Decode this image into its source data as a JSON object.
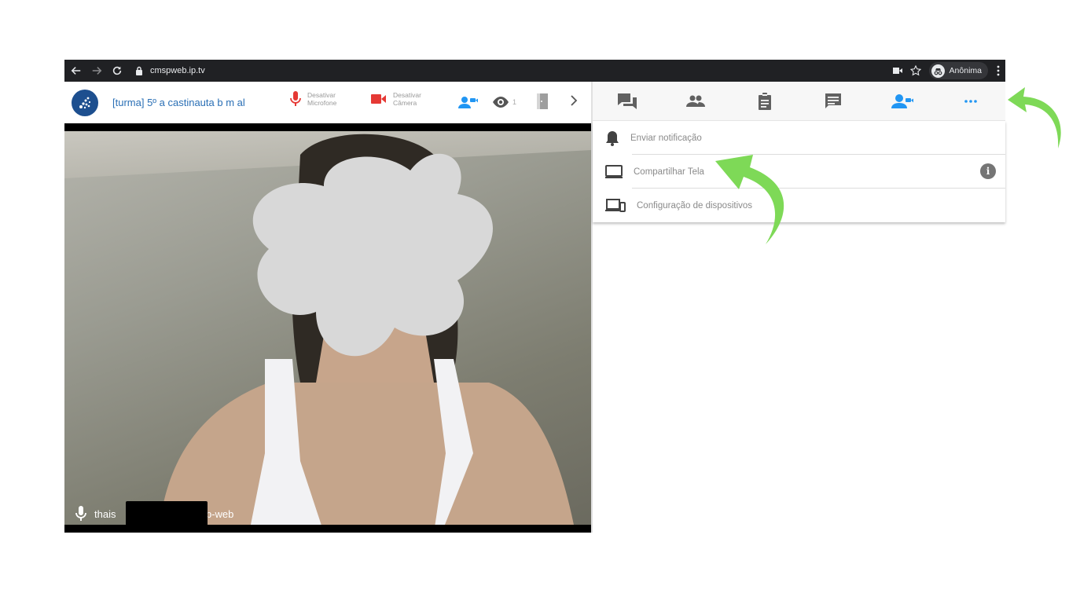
{
  "browser": {
    "url": "cmspweb.ip.tv",
    "profile_label": "Anônima"
  },
  "toolbar": {
    "room_title": "[turma] 5º a castinauta b m al",
    "mic_label_1": "Desativar",
    "mic_label_2": "Microfone",
    "cam_label_1": "Desativar",
    "cam_label_2": "Câmera",
    "viewer_count": "1",
    "colors": {
      "accent": "#2196f3",
      "mic": "#e53935",
      "cam": "#e53935",
      "title": "#2a6fb5"
    }
  },
  "video": {
    "participant_name_prefix": "thais",
    "participant_name_suffix": "sp-web"
  },
  "panel": {
    "tabs": [
      {
        "icon": "forum-icon"
      },
      {
        "icon": "people-icon"
      },
      {
        "icon": "clipboard-icon"
      },
      {
        "icon": "message-icon"
      },
      {
        "icon": "webcam-user-icon",
        "active": true
      },
      {
        "icon": "more-horizontal-icon",
        "active": true
      }
    ],
    "menu": [
      {
        "label": "Enviar notificação",
        "icon": "bell-icon"
      },
      {
        "label": "Compartilhar Tela",
        "icon": "monitor-icon",
        "info": "i"
      },
      {
        "label": "Configuração de dispositivos",
        "icon": "devices-icon"
      }
    ]
  },
  "annotation_color": "#7ed957"
}
